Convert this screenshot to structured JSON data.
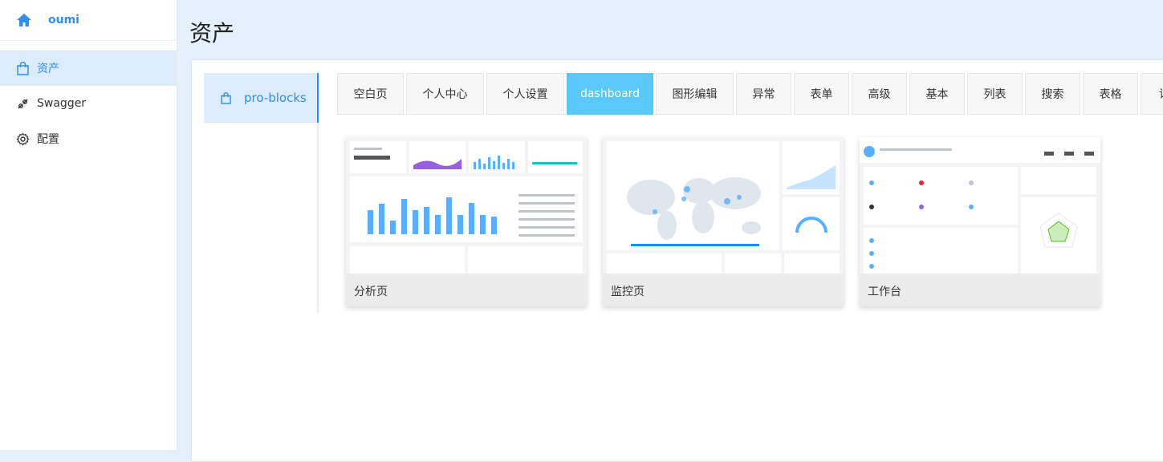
{
  "sidebar": {
    "brand": "oumi",
    "items": [
      {
        "label": "资产",
        "icon": "bag-icon",
        "active": true
      },
      {
        "label": "Swagger",
        "icon": "api-icon",
        "active": false
      },
      {
        "label": "配置",
        "icon": "gear-icon",
        "active": false
      }
    ]
  },
  "page": {
    "title": "资产"
  },
  "categories": [
    {
      "label": "pro-blocks",
      "icon": "bag-icon",
      "active": true
    }
  ],
  "tabs": [
    "空白页",
    "个人中心",
    "个人设置",
    "dashboard",
    "图形编辑",
    "异常",
    "表单",
    "高级",
    "基本",
    "列表",
    "搜索",
    "表格",
    "详"
  ],
  "active_tab": "dashboard",
  "cards": [
    {
      "label": "分析页",
      "thumb": "analysis-dashboard"
    },
    {
      "label": "监控页",
      "thumb": "monitor-dashboard"
    },
    {
      "label": "工作台",
      "thumb": "workplace-dashboard"
    }
  ],
  "colors": {
    "accent": "#2f8ef0",
    "active_tab": "#5ac8fa",
    "background": "#e4f0fb"
  }
}
